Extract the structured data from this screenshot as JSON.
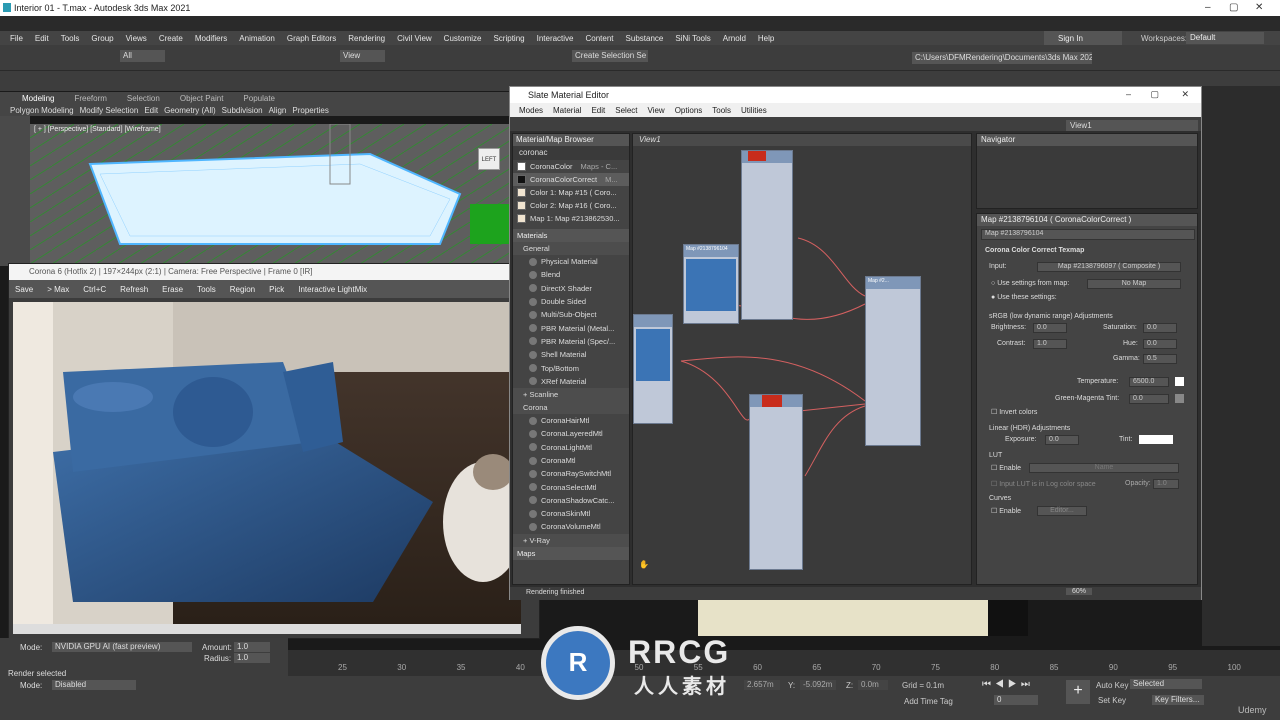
{
  "app": {
    "title": "Interior 01 - T.max - Autodesk 3ds Max 2021"
  },
  "menubar": [
    "File",
    "Edit",
    "Tools",
    "Group",
    "Views",
    "Create",
    "Modifiers",
    "Animation",
    "Graph Editors",
    "Rendering",
    "Civil View",
    "Customize",
    "Scripting",
    "Interactive",
    "Content",
    "Substance",
    "SiNi Tools",
    "Arnold",
    "Help"
  ],
  "signin": "Sign In",
  "workspaces": "Workspaces:",
  "workspace_value": "Default",
  "toolbar": {
    "filter": "All",
    "view": "View",
    "selset": "Create Selection Se",
    "path": "C:\\Users\\DFMRendering\\Documents\\3ds Max 2021"
  },
  "ribbon": {
    "tabs": [
      "Modeling",
      "Freeform",
      "Selection",
      "Object Paint",
      "Populate"
    ],
    "items": [
      "Polygon Modeling",
      "Modify Selection",
      "Edit",
      "Geometry (All)",
      "Subdivision",
      "Align",
      "Properties"
    ]
  },
  "viewport": {
    "label": "[ + ] [Perspective] [Standard] [Wireframe]"
  },
  "vfb": {
    "title": "Corona 6 (Hotfix 2) | 197×244px (2:1) | Camera: Free Perspective | Frame 0 [IR]",
    "buttons": [
      "Save",
      "> Max",
      "Ctrl+C",
      "Refresh",
      "Erase",
      "Tools",
      "Region",
      "Pick",
      "Interactive LightMix"
    ]
  },
  "sme": {
    "title": "Slate Material Editor",
    "menu": [
      "Modes",
      "Material",
      "Edit",
      "Select",
      "View",
      "Options",
      "Tools",
      "Utilities"
    ],
    "view_dropdown": "View1",
    "browser": {
      "title": "Material/Map Browser",
      "search": "coronac",
      "results": [
        {
          "name": "CoronaColor",
          "info": "Maps - C..."
        },
        {
          "name": "CoronaColorCorrect",
          "info": "M..."
        },
        {
          "name": "Color 1: Map #15  ( Coro..."
        },
        {
          "name": "Color 2: Map #16  ( Coro..."
        },
        {
          "name": "Map 1: Map #213862530..."
        }
      ],
      "materials": "Materials",
      "general": "General",
      "general_items": [
        "Physical Material",
        "Blend",
        "DirectX Shader",
        "Double Sided",
        "Multi/Sub-Object",
        "PBR Material (Metal...",
        "PBR Material (Spec/...",
        "Shell Material",
        "Top/Bottom",
        "XRef Material"
      ],
      "scanline": "+ Scanline",
      "corona": "Corona",
      "corona_items": [
        "CoronaHairMtl",
        "CoronaLayeredMtl",
        "CoronaLightMtl",
        "CoronaMtl",
        "CoronaRaySwitchMtl",
        "CoronaSelectMtl",
        "CoronaShadowCatc...",
        "CoronaSkinMtl",
        "CoronaVolumeMtl"
      ],
      "vray": "+ V-Ray",
      "maps": "Maps"
    },
    "view_tab": "View1",
    "navigator": "Navigator",
    "params": {
      "header": "Map #2138796104  ( CoronaColorCorrect )",
      "name": "Map #2138796104",
      "rollout": "Corona Color Correct Texmap",
      "input_label": "Input:",
      "input_value": "Map #2138796097  ( Composite )",
      "use_settings": "Use settings from map:",
      "no_map": "No Map",
      "use_these": "Use these settings:",
      "srgb": "sRGB (low dynamic range) Adjustments",
      "brightness": "Brightness:",
      "brightness_v": "0.0",
      "saturation": "Saturation:",
      "saturation_v": "0.0",
      "contrast": "Contrast:",
      "contrast_v": "1.0",
      "hue": "Hue:",
      "hue_v": "0.0",
      "gamma": "Gamma:",
      "gamma_v": "0.5",
      "temperature": "Temperature:",
      "temperature_v": "6500.0",
      "green_magenta": "Green-Magenta Tint:",
      "green_magenta_v": "0.0",
      "invert": "Invert colors",
      "linear": "Linear (HDR) Adjustments",
      "exposure": "Exposure:",
      "exposure_v": "0.0",
      "tint": "Tint:",
      "lut": "LUT",
      "enable": "Enable",
      "name_label": "Name",
      "lut_log": "Input LUT is in Log color space",
      "opacity": "Opacity:",
      "opacity_v": "1.0",
      "curves": "Curves",
      "editor": "Editor..."
    },
    "status": "Rendering finished",
    "zoom": "60%"
  },
  "bottom": {
    "mode_label": "Mode:",
    "mode_value": "NVIDIA GPU AI (fast preview)",
    "amount": "Amount:",
    "amount_v": "1.0",
    "radius": "Radius:",
    "radius_v": "1.0",
    "render_selected": "Render selected",
    "mode2_value": "Disabled",
    "ticks": [
      "25",
      "30",
      "35",
      "40",
      "45",
      "50",
      "55",
      "60",
      "65",
      "70",
      "75",
      "80",
      "85",
      "90",
      "95",
      "100"
    ],
    "x": "2.657m",
    "y_label": "Y:",
    "y": "-5.092m",
    "z_label": "Z:",
    "z": "0.0m",
    "grid": "Grid = 0.1m",
    "add_time_tag": "Add Time Tag",
    "auto_key": "Auto Key",
    "set_key": "Set Key",
    "selected": "Selected",
    "key_filters": "Key Filters...",
    "frame": "0"
  },
  "watermark": {
    "big": "RRCG",
    "small": "人人素材",
    "udemy": "Udemy"
  }
}
